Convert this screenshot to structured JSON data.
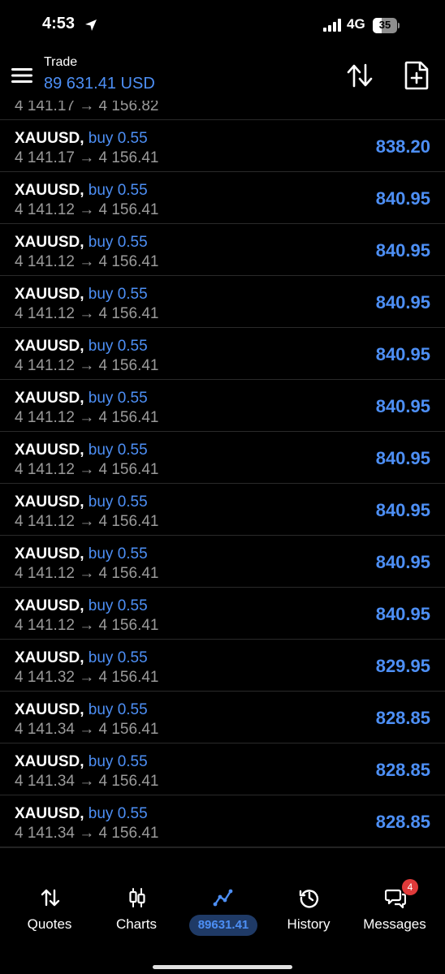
{
  "status": {
    "time": "4:53",
    "network": "4G",
    "battery": "35",
    "battery_level": 0.35
  },
  "header": {
    "title": "Trade",
    "balance": "89 631.41 USD"
  },
  "list": {
    "partial": {
      "line2": "4 141.17 → 4 156.82"
    },
    "rows": [
      {
        "symbol": "XAUUSD,",
        "side": "buy 0.55",
        "prices": "4 141.17 → 4 156.41",
        "profit": "838.20"
      },
      {
        "symbol": "XAUUSD,",
        "side": "buy 0.55",
        "prices": "4 141.12 → 4 156.41",
        "profit": "840.95"
      },
      {
        "symbol": "XAUUSD,",
        "side": "buy 0.55",
        "prices": "4 141.12 → 4 156.41",
        "profit": "840.95"
      },
      {
        "symbol": "XAUUSD,",
        "side": "buy 0.55",
        "prices": "4 141.12 → 4 156.41",
        "profit": "840.95"
      },
      {
        "symbol": "XAUUSD,",
        "side": "buy 0.55",
        "prices": "4 141.12 → 4 156.41",
        "profit": "840.95"
      },
      {
        "symbol": "XAUUSD,",
        "side": "buy 0.55",
        "prices": "4 141.12 → 4 156.41",
        "profit": "840.95"
      },
      {
        "symbol": "XAUUSD,",
        "side": "buy 0.55",
        "prices": "4 141.12 → 4 156.41",
        "profit": "840.95"
      },
      {
        "symbol": "XAUUSD,",
        "side": "buy 0.55",
        "prices": "4 141.12 → 4 156.41",
        "profit": "840.95"
      },
      {
        "symbol": "XAUUSD,",
        "side": "buy 0.55",
        "prices": "4 141.12 → 4 156.41",
        "profit": "840.95"
      },
      {
        "symbol": "XAUUSD,",
        "side": "buy 0.55",
        "prices": "4 141.12 → 4 156.41",
        "profit": "840.95"
      },
      {
        "symbol": "XAUUSD,",
        "side": "buy 0.55",
        "prices": "4 141.32 → 4 156.41",
        "profit": "829.95"
      },
      {
        "symbol": "XAUUSD,",
        "side": "buy 0.55",
        "prices": "4 141.34 → 4 156.41",
        "profit": "828.85"
      },
      {
        "symbol": "XAUUSD,",
        "side": "buy 0.55",
        "prices": "4 141.34 → 4 156.41",
        "profit": "828.85"
      },
      {
        "symbol": "XAUUSD,",
        "side": "buy 0.55",
        "prices": "4 141.34 → 4 156.41",
        "profit": "828.85"
      }
    ]
  },
  "nav": {
    "quotes": "Quotes",
    "charts": "Charts",
    "trade_balance": "89631.41",
    "history": "History",
    "messages": "Messages",
    "messages_badge": "4"
  },
  "colors": {
    "accent": "#4d8ff5",
    "background": "#000000",
    "muted": "#9a9a9a",
    "badge": "#e03a3a"
  },
  "icons": {
    "menu": "hamburger-icon",
    "sort": "sort-arrows-icon",
    "new_order": "new-order-icon",
    "quotes": "quotes-arrows-icon",
    "charts": "candlestick-icon",
    "trade": "trend-line-icon",
    "history": "history-clock-icon",
    "messages": "chat-bubbles-icon"
  }
}
